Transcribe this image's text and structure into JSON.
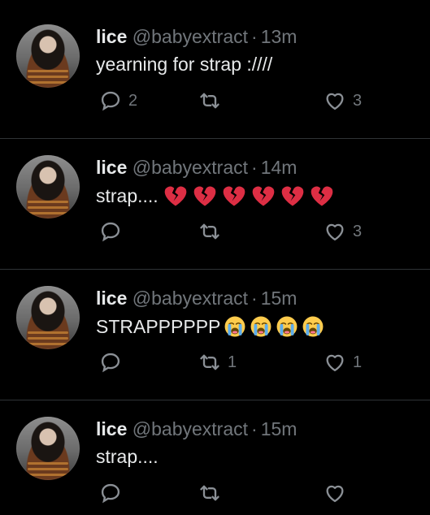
{
  "tweets": [
    {
      "name": "lice",
      "handle": "@babyextract",
      "time": "13m",
      "text": "yearning for strap :////",
      "reply_count": "2",
      "retweet_count": "",
      "like_count": "3"
    },
    {
      "name": "lice",
      "handle": "@babyextract",
      "time": "14m",
      "text": "strap....",
      "reply_count": "",
      "retweet_count": "",
      "like_count": "3"
    },
    {
      "name": "lice",
      "handle": "@babyextract",
      "time": "15m",
      "text": "STRAPPPPPP",
      "reply_count": "",
      "retweet_count": "1",
      "like_count": "1"
    },
    {
      "name": "lice",
      "handle": "@babyextract",
      "time": "15m",
      "text": "strap....",
      "reply_count": "",
      "retweet_count": "",
      "like_count": ""
    }
  ],
  "separator": "·",
  "icons": {
    "reply": "reply-icon",
    "retweet": "retweet-icon",
    "like": "like-icon",
    "broken_heart": "broken-heart-emoji",
    "sob": "loudly-crying-face-emoji"
  },
  "colors": {
    "background": "#000000",
    "primary_text": "#e7e9ea",
    "secondary_text": "#71767b",
    "divider": "#2f3336",
    "broken_heart": "#dd2e44"
  }
}
